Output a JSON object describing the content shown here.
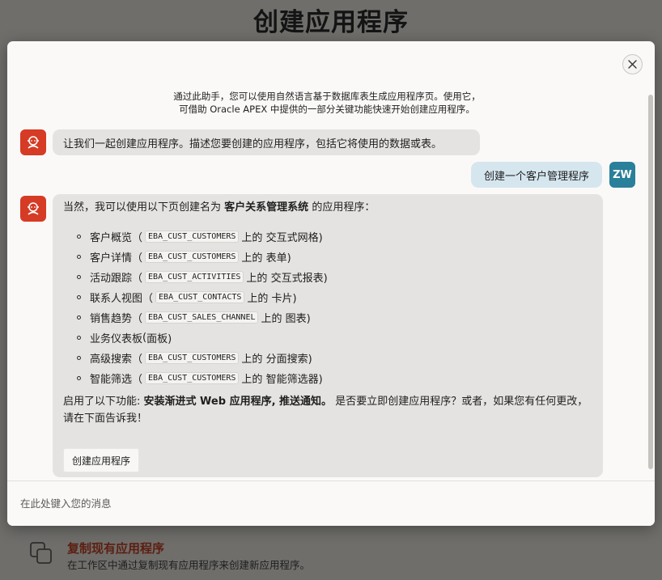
{
  "background": {
    "page_title": "创建应用程序",
    "copy_app": {
      "title": "复制现有应用程序",
      "description": "在工作区中通过复制现有应用程序来创建新应用程序。",
      "icon": "copy-icon"
    }
  },
  "dialog": {
    "close_icon": "close-icon",
    "intro_line1": "通过此助手，您可以使用自然语言基于数据库表生成应用程序页。使用它，",
    "intro_line2": "可借助 Oracle APEX 中提供的一部分关键功能快速开始创建应用程序。",
    "messages": {
      "bot1": "让我们一起创建应用程序。描述您要创建的应用程序，包括它将使用的数据或表。",
      "user": "创建一个客户管理程序",
      "user_initials": "ZW",
      "bot2": {
        "intro_prefix": "当然，我可以使用以下页创建名为",
        "app_name": "客户关系管理系统",
        "intro_suffix": "的应用程序：",
        "pages": [
          {
            "name": "客户概览",
            "open": "（",
            "table": "EBA_CUST_CUSTOMERS",
            "on": "上的",
            "type": "交互式网格)"
          },
          {
            "name": "客户详情",
            "open": "（",
            "table": "EBA_CUST_CUSTOMERS",
            "on": "上的",
            "type": "表单)"
          },
          {
            "name": "活动跟踪",
            "open": "（",
            "table": "EBA_CUST_ACTIVITIES",
            "on": "上的",
            "type": "交互式报表)"
          },
          {
            "name": "联系人视图",
            "open": "（",
            "table": "EBA_CUST_CONTACTS",
            "on": "上的",
            "type": "卡片)"
          },
          {
            "name": "销售趋势",
            "open": "（",
            "table": "EBA_CUST_SALES_CHANNEL",
            "on": "上的",
            "type": "图表)"
          },
          {
            "name": "业务仪表板",
            "open": "(",
            "table": "",
            "on": "",
            "type": "面板)"
          },
          {
            "name": "高级搜索",
            "open": "（",
            "table": "EBA_CUST_CUSTOMERS",
            "on": "上的",
            "type": "分面搜索)"
          },
          {
            "name": "智能筛选",
            "open": "（",
            "table": "EBA_CUST_CUSTOMERS",
            "on": "上的",
            "type": "智能筛选器)"
          }
        ],
        "features_prefix": "启用了以下功能:",
        "features": "安装渐进式 Web 应用程序, 推送通知。",
        "outro": "是否要立即创建应用程序？或者，如果您有任何更改，请在下面告诉我！",
        "create_button": "创建应用程序"
      }
    },
    "input_placeholder": "在此处键入您的消息"
  },
  "colors": {
    "bot_avatar": "#d63b25",
    "user_avatar": "#2a7f9a",
    "user_bubble": "#d5e6ee",
    "bot_bubble": "#e5e3e1"
  }
}
